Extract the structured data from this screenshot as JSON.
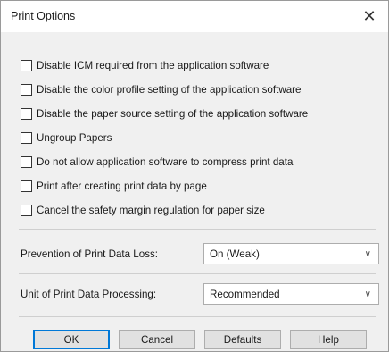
{
  "window": {
    "title": "Print Options"
  },
  "options": [
    {
      "label": "Disable ICM required from the application software",
      "checked": false
    },
    {
      "label": "Disable the color profile setting of the application software",
      "checked": false
    },
    {
      "label": "Disable the paper source setting of the application software",
      "checked": false
    },
    {
      "label": "Ungroup Papers",
      "checked": false
    },
    {
      "label": "Do not allow application software to compress print data",
      "checked": false
    },
    {
      "label": "Print after creating print data by page",
      "checked": false
    },
    {
      "label": "Cancel the safety margin regulation for paper size",
      "checked": false
    }
  ],
  "prevention": {
    "label": "Prevention of Print Data Loss:",
    "value": "On (Weak)"
  },
  "unit": {
    "label": "Unit of Print Data Processing:",
    "value": "Recommended"
  },
  "buttons": {
    "ok": "OK",
    "cancel": "Cancel",
    "defaults": "Defaults",
    "help": "Help"
  },
  "icons": {
    "close": "close-icon",
    "dropdown": "chevron-down-icon"
  }
}
